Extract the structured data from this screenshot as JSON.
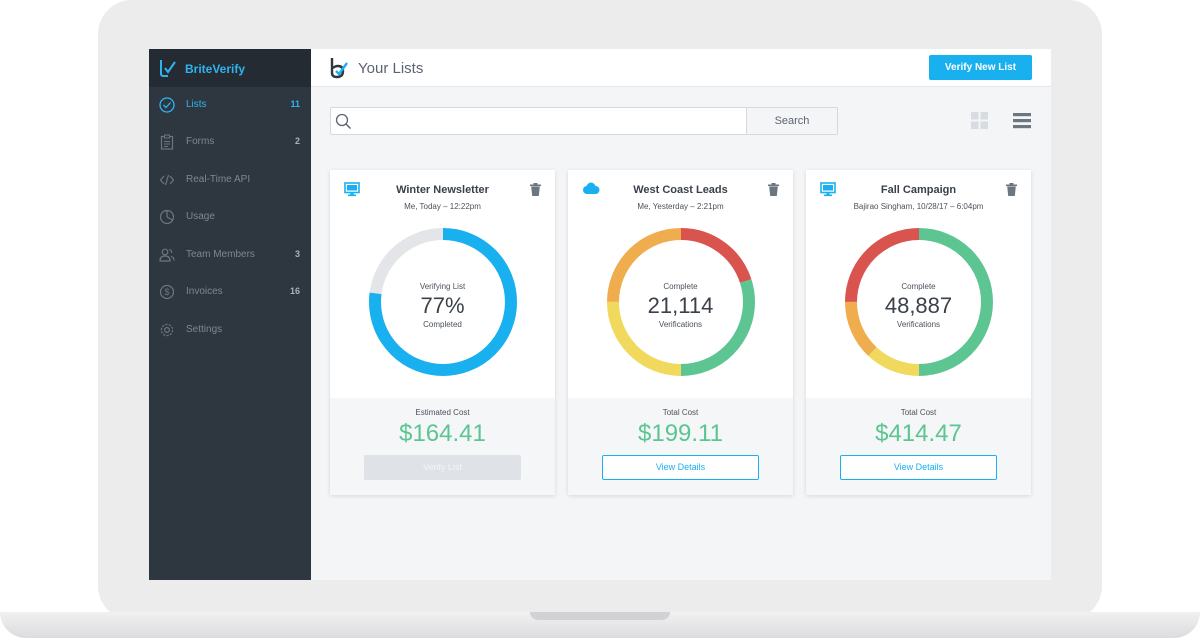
{
  "app": {
    "brand_name": "BriteVerify",
    "accent_color": "#19b0f0",
    "sidebar_bg": "#2e3640"
  },
  "sidebar": {
    "items": [
      {
        "label": "Lists",
        "count": "11",
        "icon": "check-circle-icon",
        "active": true
      },
      {
        "label": "Forms",
        "count": "2",
        "icon": "clipboard-icon"
      },
      {
        "label": "Real-Time API",
        "count": "",
        "icon": "code-icon"
      },
      {
        "label": "Usage",
        "count": "",
        "icon": "pie-chart-icon"
      },
      {
        "label": "Team Members",
        "count": "3",
        "icon": "users-icon"
      },
      {
        "label": "Invoices",
        "count": "16",
        "icon": "dollar-circle-icon"
      },
      {
        "label": "Settings",
        "count": "",
        "icon": "gear-icon"
      }
    ]
  },
  "header": {
    "title": "Your Lists",
    "verify_new_label": "Verify New List"
  },
  "search": {
    "placeholder": "",
    "button_label": "Search"
  },
  "cards": [
    {
      "title": "Winter Newsletter",
      "source_icon": "monitor-icon",
      "subtitle": "Me, Today – 12:22pm",
      "status_top": "Verifying List",
      "status_value": "77%",
      "status_bottom": "Completed",
      "progress": 0.77,
      "cost_label": "Estimated Cost",
      "cost_value": "$164.41",
      "button_label": "Verify List",
      "button_state": "disabled"
    },
    {
      "title": "West Coast Leads",
      "source_icon": "salesforce-cloud-icon",
      "subtitle": "Me, Yesterday – 2:21pm",
      "status_top": "Complete",
      "status_value": "21,114",
      "status_bottom": "Verifications",
      "segments": [
        {
          "color": "#d9534f",
          "fraction": 0.2
        },
        {
          "color": "#5cc592",
          "fraction": 0.3
        },
        {
          "color": "#f0d95c",
          "fraction": 0.25
        },
        {
          "color": "#f0ad4e",
          "fraction": 0.25
        }
      ],
      "cost_label": "Total Cost",
      "cost_value": "$199.11",
      "button_label": "View Details",
      "button_state": "outline"
    },
    {
      "title": "Fall Campaign",
      "source_icon": "monitor-icon",
      "subtitle": "Bajirao Singham, 10/28/17 – 6:04pm",
      "status_top": "Complete",
      "status_value": "48,887",
      "status_bottom": "Verifications",
      "segments": [
        {
          "color": "#5cc592",
          "fraction": 0.5
        },
        {
          "color": "#f0d95c",
          "fraction": 0.12
        },
        {
          "color": "#f0ad4e",
          "fraction": 0.13
        },
        {
          "color": "#d9534f",
          "fraction": 0.25
        }
      ],
      "cost_label": "Total Cost",
      "cost_value": "$414.47",
      "button_label": "View Details",
      "button_state": "outline"
    }
  ]
}
